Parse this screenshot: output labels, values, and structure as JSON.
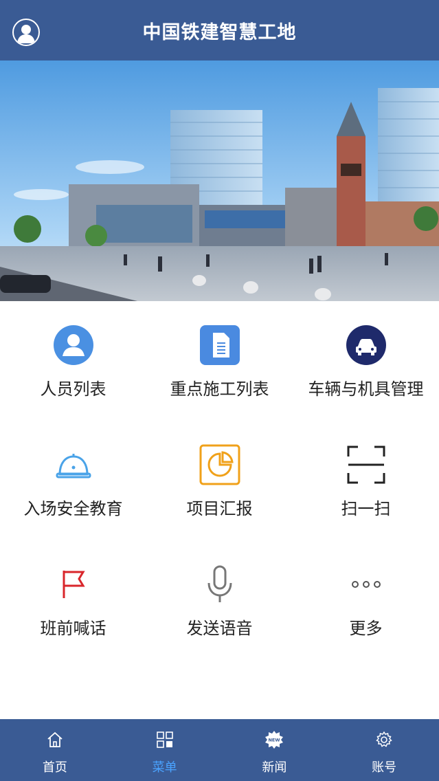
{
  "header": {
    "title": "中国铁建智慧工地",
    "avatar_icon": "user-avatar-icon"
  },
  "banner": {
    "image": "construction-site-rendering-photo"
  },
  "menu": {
    "items": [
      {
        "label": "人员列表",
        "icon": "person-circle-icon"
      },
      {
        "label": "重点施工列表",
        "icon": "document-icon"
      },
      {
        "label": "车辆与机具管理",
        "icon": "car-icon"
      },
      {
        "label": "入场安全教育",
        "icon": "hard-hat-icon"
      },
      {
        "label": "项目汇报",
        "icon": "pie-chart-icon"
      },
      {
        "label": "扫一扫",
        "icon": "scan-icon"
      },
      {
        "label": "班前喊话",
        "icon": "flag-icon"
      },
      {
        "label": "发送语音",
        "icon": "microphone-icon"
      },
      {
        "label": "更多",
        "icon": "more-dots-icon"
      }
    ]
  },
  "tabbar": {
    "active": "菜单",
    "tabs": [
      {
        "label": "首页",
        "icon": "home-icon"
      },
      {
        "label": "菜单",
        "icon": "grid-menu-icon"
      },
      {
        "label": "新闻",
        "icon": "new-badge-icon"
      },
      {
        "label": "账号",
        "icon": "gear-icon"
      }
    ]
  },
  "colors": {
    "header_bg": "#3a5b94",
    "tab_active": "#4aa3ff",
    "icon_blue": "#4a90e2",
    "icon_navy": "#1f2a6b",
    "icon_orange": "#f0a11a",
    "icon_red": "#d9262b"
  }
}
